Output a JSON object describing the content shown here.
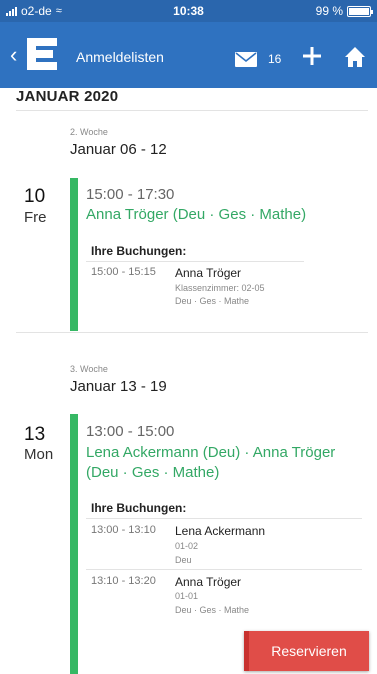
{
  "status_bar": {
    "carrier": "o2-de",
    "time": "10:38",
    "battery": "99 %",
    "battery_level": 0.99
  },
  "nav": {
    "back_icon": "chevron-left-icon",
    "logo_letter": "E",
    "title": "Anmeldelisten",
    "mail_count": "16",
    "icons": [
      "mail-icon",
      "plus-icon",
      "home-icon"
    ]
  },
  "month": "JANUAR 2020",
  "weeks": [
    {
      "label": "2. Woche",
      "range": "Januar 06 - 12",
      "days": [
        {
          "day_num": "10",
          "day_name": "Fre",
          "slot_time": "15:00 - 17:30",
          "teachers": "Anna Tröger (Deu · Ges · Mathe)",
          "bookings_label": "Ihre Buchungen:",
          "bookings": [
            {
              "time": "15:00 - 15:15",
              "name": "Anna Tröger",
              "room": "Klassenzimmer: 02-05",
              "subjects": "Deu · Ges · Mathe"
            }
          ]
        }
      ]
    },
    {
      "label": "3. Woche",
      "range": "Januar 13 - 19",
      "days": [
        {
          "day_num": "13",
          "day_name": "Mon",
          "slot_time": "13:00 - 15:00",
          "teachers_line1": "Lena Ackermann (Deu) · Anna Tröger",
          "teachers_line2": "(Deu · Ges · Mathe)",
          "bookings_label": "Ihre Buchungen:",
          "bookings": [
            {
              "time": "13:00 - 13:10",
              "name": "Lena Ackermann",
              "room": "01-02",
              "subjects": "Deu"
            },
            {
              "time": "13:10 - 13:20",
              "name": "Anna Tröger",
              "room": "01-01",
              "subjects": "Deu · Ges · Mathe"
            }
          ]
        }
      ]
    }
  ],
  "reserve_button": "Reservieren",
  "colors": {
    "header": "#2f72c0",
    "accent_green": "#36b864",
    "button_red": "#e04d48"
  }
}
